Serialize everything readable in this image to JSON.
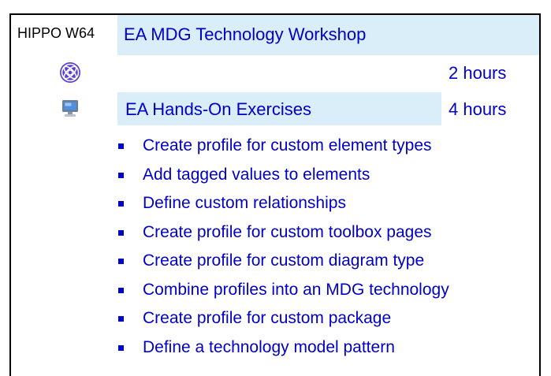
{
  "course": {
    "id": "HIPPO W64",
    "title": "EA MDG Technology Workshop"
  },
  "sessions": [
    {
      "icon": "presentation-knot-icon",
      "label": "",
      "duration": "2 hours"
    },
    {
      "icon": "computer-monitor-icon",
      "label": "EA Hands-On Exercises",
      "duration": "4 hours"
    }
  ],
  "exercises": [
    "Create profile for custom element types",
    "Add tagged values to elements",
    "Define custom relationships",
    "Create profile for custom toolbox pages",
    "Create profile for custom diagram type",
    "Combine profiles into an MDG technology",
    "Create profile for custom package",
    "Define a technology model pattern"
  ],
  "colors": {
    "band": "#d9eef8",
    "text_accent": "#0000c8",
    "border": "#000000"
  }
}
